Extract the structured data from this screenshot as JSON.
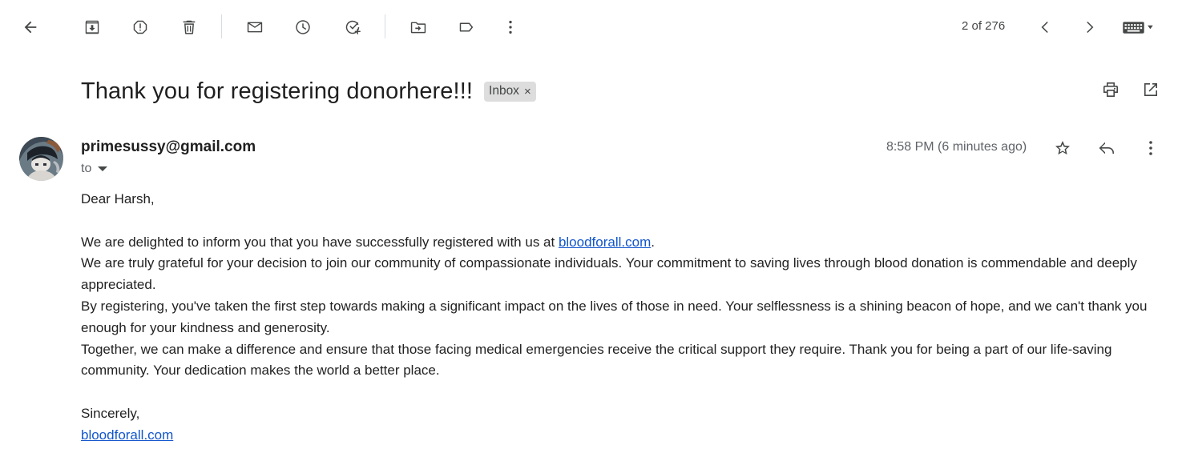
{
  "toolbar": {
    "icons": [
      "back-arrow-icon",
      "archive-icon",
      "report-spam-icon",
      "delete-icon",
      "mark-unread-icon",
      "snooze-icon",
      "add-to-tasks-icon",
      "move-to-icon",
      "label-icon",
      "more-vert-icon"
    ],
    "pager": "2 of 276",
    "pager_icons": [
      "chevron-left-icon",
      "chevron-right-icon",
      "keyboard-icon"
    ]
  },
  "email": {
    "subject": "Thank you for registering donorhere!!!",
    "label": "Inbox",
    "label_remove": "×",
    "sender": "primesussy@gmail.com",
    "to": "to",
    "timestamp": "8:58 PM (6 minutes ago)",
    "greeting": "Dear Harsh,",
    "para1_prefix": "We are delighted to inform you that you have successfully registered with us at ",
    "link": "bloodforall.com",
    "para1_suffix": ".",
    "para2": "We are truly grateful for your decision to join our community of compassionate individuals. Your commitment to saving lives through blood donation is commendable and deeply appreciated.",
    "para3": "By registering, you've taken the first step towards making a significant impact on the lives of those in need. Your selflessness is a shining beacon of hope, and we can't thank you enough for your kindness and generosity.",
    "para4": "Together, we can make a difference and ensure that those facing medical emergencies receive the critical support they require. Thank you for being a part of our life-saving community. Your dedication makes the world a better place.",
    "closing": "Sincerely,",
    "signature_link": "bloodforall.com"
  },
  "colors": {
    "link": "#1155cc",
    "icon": "#444746",
    "chip_bg": "#dddddd"
  }
}
